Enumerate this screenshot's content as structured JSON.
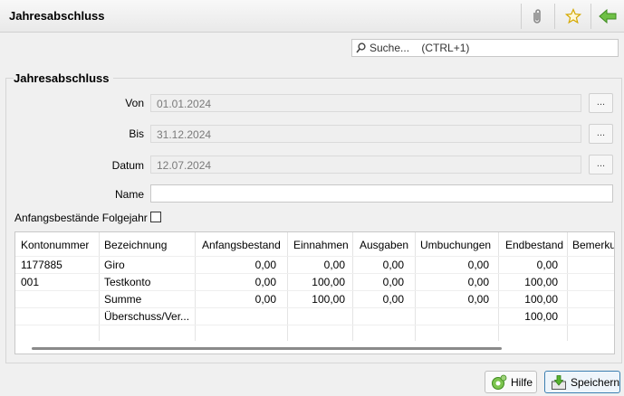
{
  "window": {
    "title": "Jahresabschluss",
    "toolbar": {
      "attach_icon": "paperclip-icon",
      "favorite_icon": "star-icon",
      "back_icon": "arrow-left-icon"
    }
  },
  "search": {
    "placeholder": "Suche...    (CTRL+1)",
    "value": ""
  },
  "form": {
    "group_title": "Jahresabschluss",
    "von_label": "Von",
    "von_value": "01.01.2024",
    "bis_label": "Bis",
    "bis_value": "31.12.2024",
    "datum_label": "Datum",
    "datum_value": "12.07.2024",
    "name_label": "Name",
    "name_value": "",
    "ellipsis": "...",
    "checkbox_label": "Anfangsbestände Folgejahr",
    "checkbox_checked": false
  },
  "table": {
    "headers": [
      "Kontonummer",
      "Bezeichnung",
      "Anfangsbestand",
      "Einnahmen",
      "Ausgaben",
      "Umbuchungen",
      "Endbestand",
      "Bemerku"
    ],
    "rows": [
      [
        "1177885",
        "Giro",
        "0,00",
        "0,00",
        "0,00",
        "0,00",
        "0,00",
        ""
      ],
      [
        "001",
        "Testkonto",
        "0,00",
        "100,00",
        "0,00",
        "0,00",
        "100,00",
        ""
      ],
      [
        "",
        "Summe",
        "0,00",
        "100,00",
        "0,00",
        "0,00",
        "100,00",
        ""
      ],
      [
        "",
        "Überschuss/Ver...",
        "",
        "",
        "",
        "",
        "100,00",
        ""
      ]
    ]
  },
  "buttons": {
    "help_label": "Hilfe",
    "save_label": "Speichern"
  },
  "colors": {
    "accent_green": "#4aa32b",
    "primary_border": "#3c7fb1"
  }
}
